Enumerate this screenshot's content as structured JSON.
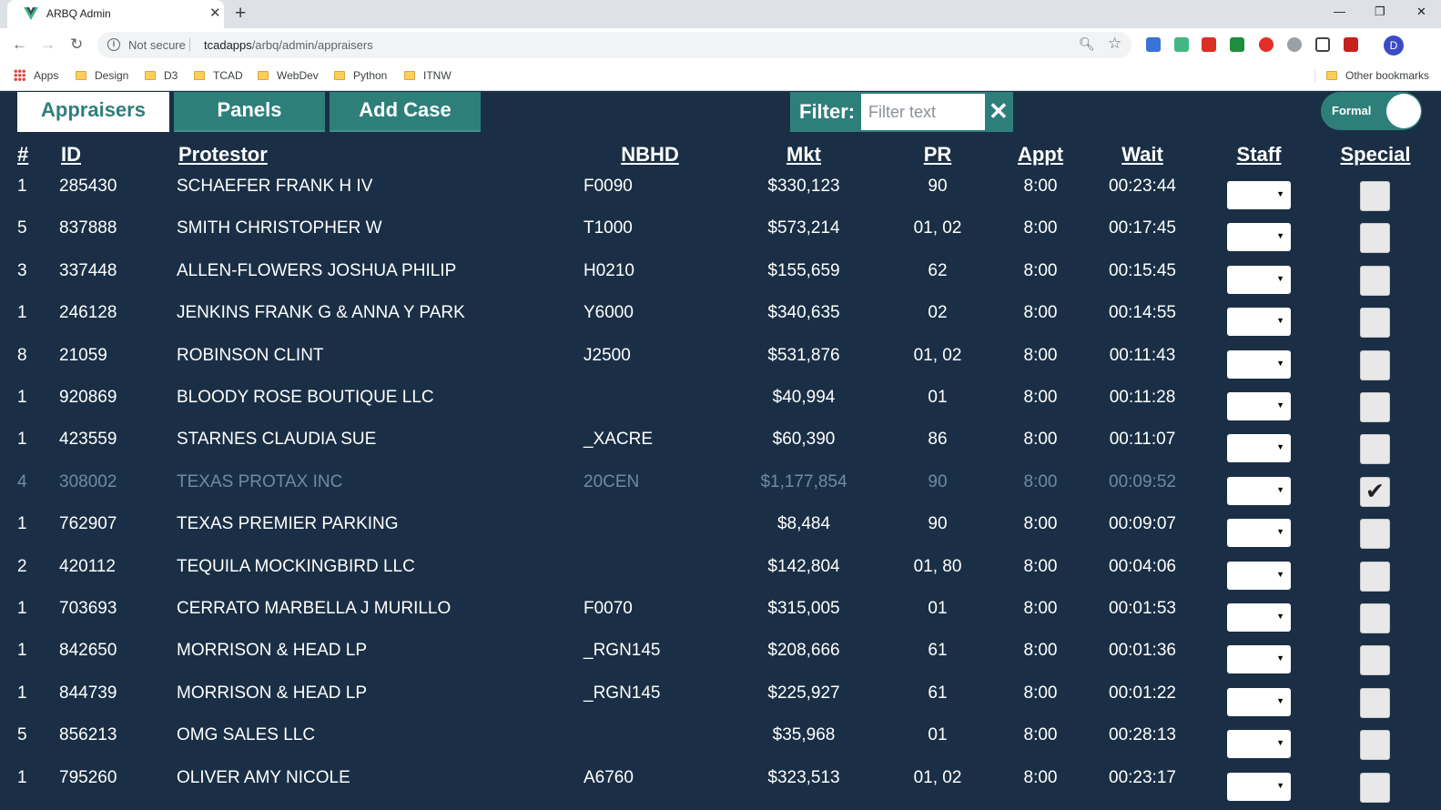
{
  "browser": {
    "tab_title": "ARBQ Admin",
    "close_tab": "✕",
    "new_tab": "+",
    "security_label": "Not secure",
    "url_host": "tcadapps",
    "url_path": "/arbq/admin/appraisers",
    "avatar_letter": "D",
    "window_controls": [
      "—",
      "❐",
      "✕"
    ],
    "bookmarks": [
      "Apps",
      "Design",
      "D3",
      "TCAD",
      "WebDev",
      "Python",
      "ITNW"
    ],
    "other_bookmarks": "Other bookmarks"
  },
  "nav": {
    "tabs": [
      {
        "label": "Appraisers",
        "active": true
      },
      {
        "label": "Panels",
        "active": false
      },
      {
        "label": "Add Case",
        "active": false
      }
    ]
  },
  "filter": {
    "label": "Filter:",
    "placeholder": "Filter text",
    "clear": "✕"
  },
  "toggle": {
    "label": "Formal",
    "on": true
  },
  "colors": {
    "background": "#1a2f45",
    "accent": "#2e7f7a",
    "dim_text": "#6e8aa7"
  },
  "table": {
    "headers": [
      "#",
      "ID",
      "Protestor",
      "NBHD",
      "Mkt",
      "PR",
      "Appt",
      "Wait",
      "Staff",
      "Special"
    ],
    "rows": [
      {
        "n": "1",
        "id": "285430",
        "protestor": "SCHAEFER FRANK H IV",
        "nbhd": "F0090",
        "mkt": "$330,123",
        "pr": "90",
        "appt": "8:00",
        "wait": "00:23:44",
        "special": false,
        "dim": false
      },
      {
        "n": "5",
        "id": "837888",
        "protestor": "SMITH CHRISTOPHER W",
        "nbhd": "T1000",
        "mkt": "$573,214",
        "pr": "01, 02",
        "appt": "8:00",
        "wait": "00:17:45",
        "special": false,
        "dim": false
      },
      {
        "n": "3",
        "id": "337448",
        "protestor": "ALLEN-FLOWERS JOSHUA PHILIP",
        "nbhd": "H0210",
        "mkt": "$155,659",
        "pr": "62",
        "appt": "8:00",
        "wait": "00:15:45",
        "special": false,
        "dim": false
      },
      {
        "n": "1",
        "id": "246128",
        "protestor": "JENKINS FRANK G & ANNA Y PARK",
        "nbhd": "Y6000",
        "mkt": "$340,635",
        "pr": "02",
        "appt": "8:00",
        "wait": "00:14:55",
        "special": false,
        "dim": false
      },
      {
        "n": "8",
        "id": "21059",
        "protestor": "ROBINSON CLINT",
        "nbhd": "J2500",
        "mkt": "$531,876",
        "pr": "01, 02",
        "appt": "8:00",
        "wait": "00:11:43",
        "special": false,
        "dim": false
      },
      {
        "n": "1",
        "id": "920869",
        "protestor": "BLOODY ROSE BOUTIQUE LLC",
        "nbhd": "",
        "mkt": "$40,994",
        "pr": "01",
        "appt": "8:00",
        "wait": "00:11:28",
        "special": false,
        "dim": false
      },
      {
        "n": "1",
        "id": "423559",
        "protestor": "STARNES CLAUDIA SUE",
        "nbhd": "_XACRE",
        "mkt": "$60,390",
        "pr": "86",
        "appt": "8:00",
        "wait": "00:11:07",
        "special": false,
        "dim": false
      },
      {
        "n": "4",
        "id": "308002",
        "protestor": "TEXAS PROTAX INC",
        "nbhd": "20CEN",
        "mkt": "$1,177,854",
        "pr": "90",
        "appt": "8:00",
        "wait": "00:09:52",
        "special": true,
        "dim": true
      },
      {
        "n": "1",
        "id": "762907",
        "protestor": "TEXAS PREMIER PARKING",
        "nbhd": "",
        "mkt": "$8,484",
        "pr": "90",
        "appt": "8:00",
        "wait": "00:09:07",
        "special": false,
        "dim": false
      },
      {
        "n": "2",
        "id": "420112",
        "protestor": "TEQUILA MOCKINGBIRD LLC",
        "nbhd": "",
        "mkt": "$142,804",
        "pr": "01, 80",
        "appt": "8:00",
        "wait": "00:04:06",
        "special": false,
        "dim": false
      },
      {
        "n": "1",
        "id": "703693",
        "protestor": "CERRATO MARBELLA J MURILLO",
        "nbhd": "F0070",
        "mkt": "$315,005",
        "pr": "01",
        "appt": "8:00",
        "wait": "00:01:53",
        "special": false,
        "dim": false
      },
      {
        "n": "1",
        "id": "842650",
        "protestor": "MORRISON & HEAD LP",
        "nbhd": "_RGN145",
        "mkt": "$208,666",
        "pr": "61",
        "appt": "8:00",
        "wait": "00:01:36",
        "special": false,
        "dim": false
      },
      {
        "n": "1",
        "id": "844739",
        "protestor": "MORRISON & HEAD LP",
        "nbhd": "_RGN145",
        "mkt": "$225,927",
        "pr": "61",
        "appt": "8:00",
        "wait": "00:01:22",
        "special": false,
        "dim": false
      },
      {
        "n": "5",
        "id": "856213",
        "protestor": "OMG SALES LLC",
        "nbhd": "",
        "mkt": "$35,968",
        "pr": "01",
        "appt": "8:00",
        "wait": "00:28:13",
        "special": false,
        "dim": false
      },
      {
        "n": "1",
        "id": "795260",
        "protestor": "OLIVER AMY NICOLE",
        "nbhd": "A6760",
        "mkt": "$323,513",
        "pr": "01, 02",
        "appt": "8:00",
        "wait": "00:23:17",
        "special": false,
        "dim": false
      }
    ]
  }
}
